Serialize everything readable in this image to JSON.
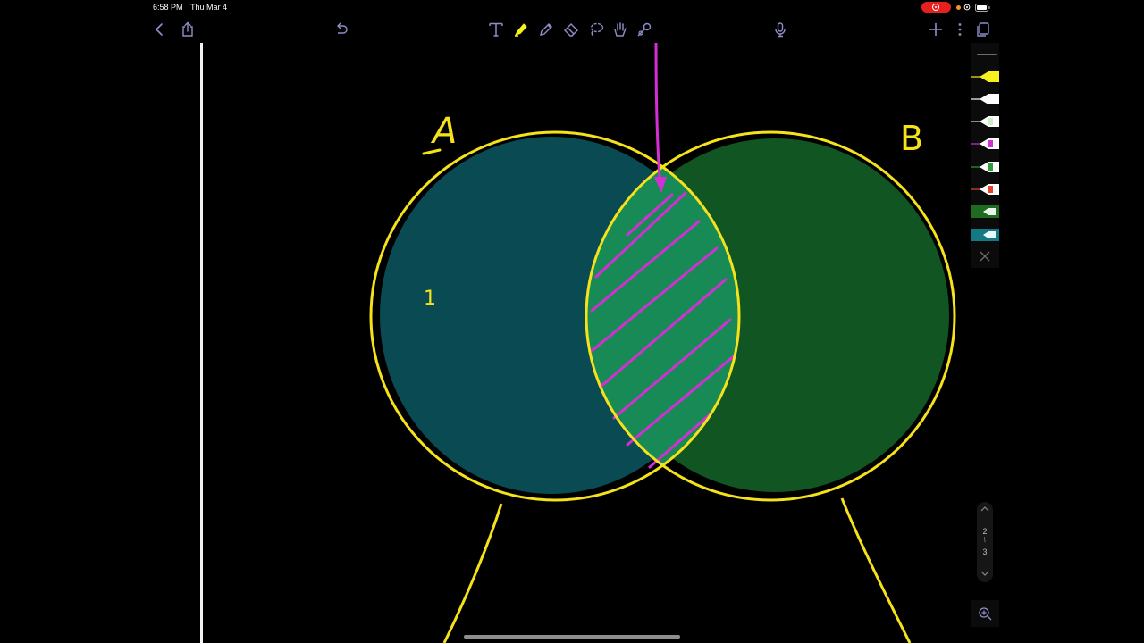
{
  "status_bar": {
    "time": "6:58 PM",
    "date": "Thu Mar 4",
    "recording_color": "#e5201f",
    "mic_indicator_color": "#f0962a"
  },
  "toolbar": {
    "left_icons": [
      "back-chevron-icon",
      "share-icon"
    ],
    "center_left_icons": [
      "undo-icon"
    ],
    "tools": [
      "text-tool-icon",
      "highlighter-tool-icon",
      "pen-tool-icon",
      "eraser-tool-icon",
      "lasso-tool-icon",
      "hand-tool-icon",
      "shape-tool-icon"
    ],
    "right_icons": [
      "microphone-icon",
      "add-icon",
      "more-icon",
      "pages-icon"
    ],
    "icon_color": "#8e8ec8",
    "active_tool": "highlighter-tool-icon"
  },
  "drawing": {
    "label_a": "A",
    "label_b": "B",
    "region_label": "1",
    "stroke_color": "#f5e21b",
    "fill_a": "#0a4a52",
    "fill_b": "#115522",
    "fill_intersection": "#178a55",
    "hatch_color": "#d42fd4"
  },
  "pen_palette": {
    "swatches": [
      {
        "name": "yellow-highlighter",
        "color": "#f7f01f"
      },
      {
        "name": "white-highlighter",
        "color": "#ffffff"
      },
      {
        "name": "light-green-highlighter",
        "color": "#c9f0c9"
      },
      {
        "name": "magenta-highlighter",
        "color": "#d42fd4"
      },
      {
        "name": "green-highlighter",
        "color": "#2e9b3c"
      },
      {
        "name": "red-highlighter",
        "color": "#e2452d"
      },
      {
        "name": "dark-green-highlighter",
        "color": "#1f6b22"
      },
      {
        "name": "teal-highlighter",
        "color": "#137a83"
      }
    ]
  },
  "page_nav": {
    "current": "2",
    "separator": "/",
    "total": "3"
  }
}
